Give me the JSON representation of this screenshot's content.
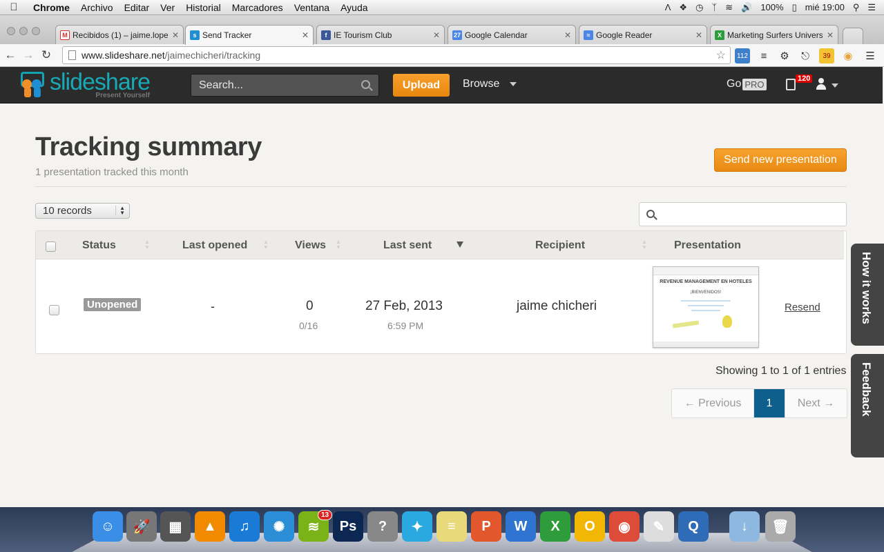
{
  "menubar": {
    "app": "Chrome",
    "items": [
      "Archivo",
      "Editar",
      "Ver",
      "Historial",
      "Marcadores",
      "Ventana",
      "Ayuda"
    ],
    "battery": "100%",
    "clock": "mié 19:00"
  },
  "tabs": [
    {
      "label": "Recibidos (1) – jaime.lope",
      "favicon": "gmail-icon",
      "color": "#d93025"
    },
    {
      "label": "Send Tracker",
      "favicon": "slideshare-icon",
      "color": "#1e8fd5"
    },
    {
      "label": "IE Tourism Club",
      "favicon": "facebook-icon",
      "color": "#3b5998"
    },
    {
      "label": "Google Calendar",
      "favicon": "calendar-icon",
      "color": "#4a86e8",
      "favtext": "27"
    },
    {
      "label": "Google Reader",
      "favicon": "reader-icon",
      "color": "#4a86e8"
    },
    {
      "label": "Marketing Surfers Univers",
      "favicon": "excel-icon",
      "color": "#2e9c3a"
    }
  ],
  "address": {
    "domain": "www.slideshare.net",
    "path": "/jaimechicheri/tracking"
  },
  "extensions": {
    "badge1": "112",
    "badge2": "39"
  },
  "slideshare": {
    "logo_text": "slideshare",
    "tagline": "Present Yourself",
    "search_placeholder": "Search...",
    "upload": "Upload",
    "browse": "Browse",
    "go": "Go",
    "pro": "PRO",
    "notifications": "120"
  },
  "page": {
    "title": "Tracking summary",
    "subtitle": "1 presentation tracked this month",
    "send_new": "Send new presentation",
    "records": "10 records"
  },
  "table": {
    "headers": [
      "Status",
      "Last opened",
      "Views",
      "Last sent",
      "Recipient",
      "Presentation"
    ],
    "rows": [
      {
        "status": "Unopened",
        "last_opened": "-",
        "views": "0",
        "views_detail": "0/16",
        "last_sent_date": "27 Feb, 2013",
        "last_sent_time": "6:59 PM",
        "recipient": "jaime chicheri",
        "thumb_title": "REVENUE MANAGEMENT EN HOTELES",
        "thumb_sub": "¡BIENVENIDOS!",
        "action": "Resend"
      }
    ]
  },
  "footer": {
    "showing": "Showing 1 to 1 of 1 entries",
    "prev": "← Previous",
    "current": "1",
    "next": "Next →"
  },
  "sidetabs": {
    "how": "How it works",
    "feedback": "Feedback"
  },
  "dock": {
    "badge": "13",
    "apps": [
      {
        "name": "finder-icon",
        "color": "#3a8ee6",
        "glyph": "☺"
      },
      {
        "name": "launchpad-icon",
        "color": "#777",
        "glyph": "🚀"
      },
      {
        "name": "photo-app-icon",
        "color": "#555",
        "glyph": "▦"
      },
      {
        "name": "vlc-icon",
        "color": "#f28a00",
        "glyph": "▲"
      },
      {
        "name": "itunes-icon",
        "color": "#1a7bd6",
        "glyph": "♫"
      },
      {
        "name": "safari-icon",
        "color": "#2c8ed6",
        "glyph": "✺"
      },
      {
        "name": "spotify-icon",
        "color": "#7ab317",
        "glyph": "≋"
      },
      {
        "name": "photoshop-icon",
        "color": "#0c2752",
        "glyph": "Ps"
      },
      {
        "name": "help-icon",
        "color": "#888",
        "glyph": "?"
      },
      {
        "name": "twitter-icon",
        "color": "#2aa9e0",
        "glyph": "✦"
      },
      {
        "name": "stickies-icon",
        "color": "#e8d97a",
        "glyph": "≡"
      },
      {
        "name": "powerpoint-icon",
        "color": "#e2572c",
        "glyph": "P"
      },
      {
        "name": "word-icon",
        "color": "#2f74d0",
        "glyph": "W"
      },
      {
        "name": "excel-icon",
        "color": "#2e9c3a",
        "glyph": "X"
      },
      {
        "name": "outlook-icon",
        "color": "#f2b705",
        "glyph": "O"
      },
      {
        "name": "chrome-icon",
        "color": "#dd4b39",
        "glyph": "◉"
      },
      {
        "name": "preview-icon",
        "color": "#ddd",
        "glyph": "✎"
      },
      {
        "name": "quicktime-icon",
        "color": "#2f6cb8",
        "glyph": "Q"
      },
      {
        "name": "downloads-folder-icon",
        "color": "#8eb8df",
        "glyph": "↓"
      },
      {
        "name": "trash-icon",
        "color": "#aaa",
        "glyph": "🗑"
      }
    ]
  }
}
